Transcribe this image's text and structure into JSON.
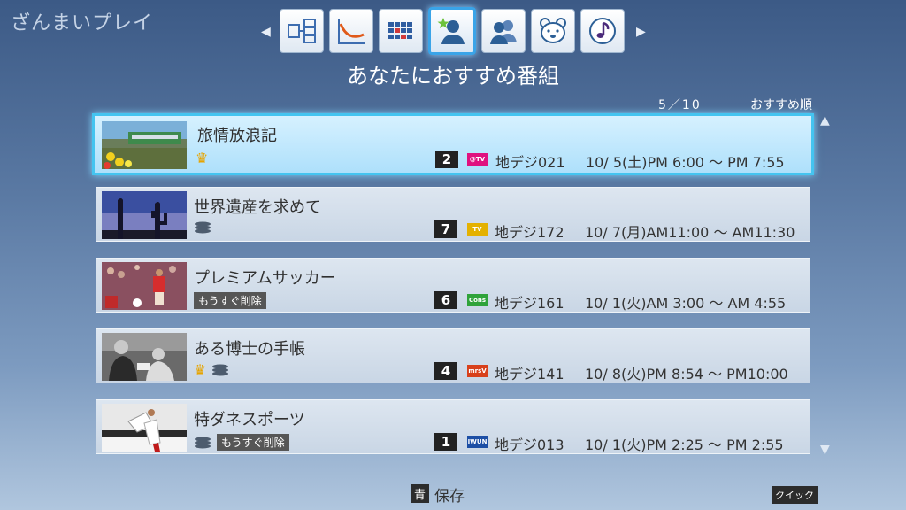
{
  "app": {
    "title": "ざんまいプレイ"
  },
  "nav": {
    "tabs": [
      {
        "icon": "program-tree-icon",
        "active": false
      },
      {
        "icon": "trend-chart-icon",
        "active": false
      },
      {
        "icon": "grid-guide-icon",
        "active": false
      },
      {
        "icon": "recommended-person-icon",
        "active": true
      },
      {
        "icon": "people-icon",
        "active": false
      },
      {
        "icon": "bear-icon",
        "active": false
      },
      {
        "icon": "music-note-icon",
        "active": false
      }
    ]
  },
  "section": {
    "title": "あなたにおすすめ番組"
  },
  "list": {
    "page_indicator": "5／10",
    "sort_order": "おすすめ順",
    "items": [
      {
        "title": "旅情放浪記",
        "crown": true,
        "disk": false,
        "expire_label": "",
        "channel_number": "2",
        "logo_color": "#e0117f",
        "logo_text": "@TV",
        "channel": "地デジ021",
        "airtime": "10/ 5(土)PM 6:00 ～ PM 7:55",
        "selected": true
      },
      {
        "title": "世界遺産を求めて",
        "crown": false,
        "disk": true,
        "expire_label": "",
        "channel_number": "7",
        "logo_color": "#e4b100",
        "logo_text": "TV",
        "channel": "地デジ172",
        "airtime": "10/ 7(月)AM11:00 ～ AM11:30",
        "selected": false
      },
      {
        "title": "プレミアムサッカー",
        "crown": false,
        "disk": false,
        "expire_label": "もうすぐ削除",
        "channel_number": "6",
        "logo_color": "#2fa33a",
        "logo_text": "Cons",
        "channel": "地デジ161",
        "airtime": "10/ 1(火)AM 3:00 ～ AM 4:55",
        "selected": false
      },
      {
        "title": "ある博士の手帳",
        "crown": true,
        "disk": true,
        "expire_label": "",
        "channel_number": "4",
        "logo_color": "#d8401b",
        "logo_text": "mrsV",
        "channel": "地デジ141",
        "airtime": "10/ 8(火)PM 8:54 ～ PM10:00",
        "selected": false
      },
      {
        "title": "特ダネスポーツ",
        "crown": false,
        "disk": true,
        "expire_label": "もうすぐ削除",
        "channel_number": "1",
        "logo_color": "#1d4fa5",
        "logo_text": "IWUN",
        "channel": "地デジ013",
        "airtime": "10/ 1(火)PM 2:25 ～ PM 2:55",
        "selected": false
      }
    ]
  },
  "footer": {
    "save_key": "青",
    "save_label": "保存",
    "quick_label": "クイック"
  },
  "colors": {
    "accent": "#44c4f0",
    "crown": "#e6a400"
  }
}
